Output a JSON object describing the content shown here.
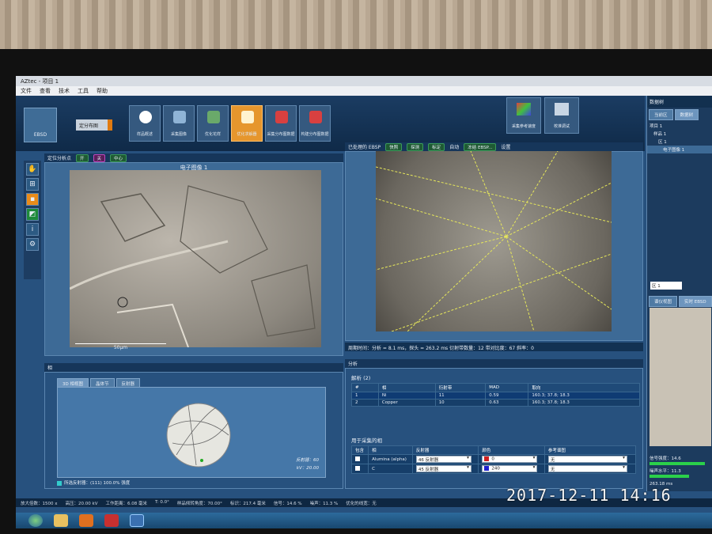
{
  "app": {
    "title": "AZtec - 项目 1",
    "menu": [
      "文件",
      "查看",
      "技术",
      "工具",
      "帮助"
    ]
  },
  "ribbon": {
    "ebsd_label": "EBSD",
    "mode_label": "定分布图",
    "steps": [
      "样品概述",
      "采集图像",
      "优化花样",
      "优化求解器",
      "采集分布图数据",
      "构建分布图数据"
    ],
    "right_buttons": [
      "采集参考速度",
      "校准调试"
    ]
  },
  "left_view": {
    "header_label": "定位分析点",
    "toggles": [
      "开",
      "关",
      "中心"
    ],
    "image_title": "电子图像 1",
    "scale_bar": "50μm"
  },
  "ebsp_view": {
    "header_label": "已处理的 EBSP",
    "buttons": [
      "快照",
      "探测",
      "标定",
      "自动",
      "冻结 EBSP...",
      "设置"
    ],
    "status": "周期时间：分析 = 8.1 ms，探头 = 263.2 ms     衍射带数量：12     带对比度：67     斜率：0"
  },
  "phase_panel": {
    "title": "相",
    "tabs": [
      "3D 相视图",
      "晶体节",
      "反射器"
    ],
    "info_line1": "反射器：60",
    "info_line2": "kV：20.00",
    "footer": "所选反射器：(111) 100.0% 强度"
  },
  "analysis_panel": {
    "title": "分析",
    "solution_label": "解析 (2)",
    "columns": [
      "#",
      "相",
      "衍射带",
      "MAD",
      "取向"
    ],
    "rows": [
      {
        "n": "1",
        "phase": "Ni",
        "bands": "11",
        "mad": "0.59",
        "orientation": "160.3; 37.8; 18.3"
      },
      {
        "n": "2",
        "phase": "Copper",
        "bands": "10",
        "mad": "0.63",
        "orientation": "160.3; 37.8; 18.3"
      }
    ],
    "phases_title": "用于采集的相",
    "phase_columns": [
      "包含",
      "相",
      "反射器",
      "颜色",
      "参考谱图"
    ],
    "phase_rows": [
      {
        "name": "Alumina (alpha)",
        "reflectors": "46 反射器",
        "color_value": "0",
        "ref": "无",
        "color": "#d02020"
      },
      {
        "name": "C",
        "reflectors": "45 反射器",
        "color_value": "240",
        "ref": "无",
        "color": "#2020d0"
      }
    ]
  },
  "right_panel": {
    "title": "数据树",
    "tabs": [
      "当前区",
      "数据树"
    ],
    "tree": [
      "项目 1",
      "样品 1",
      "区 1",
      "电子图像 1"
    ],
    "region_select": "区 1",
    "view_tabs": [
      "谱仪视图",
      "实时 EBSD"
    ],
    "signal_strength": "信号强度：14.6",
    "noise_level": "噪声水平：11.3",
    "bottom_note": "263.18 ms"
  },
  "statusbar": {
    "items": [
      "放大倍数：1500 x",
      "高压：20.00 kV",
      "工作距离：6.08 毫米",
      "T: 0.0°",
      "样品倾转角度：70.00°",
      "标识：217.4 毫米",
      "信号：14.6 %",
      "噪声：11.3 %",
      "优化的线宽：无"
    ]
  },
  "photo_timestamp": "2017-12-11  14:16",
  "colors": {
    "accent": "#e6962d",
    "panel": "#27517e",
    "pattern_line": "#e7e85a"
  }
}
